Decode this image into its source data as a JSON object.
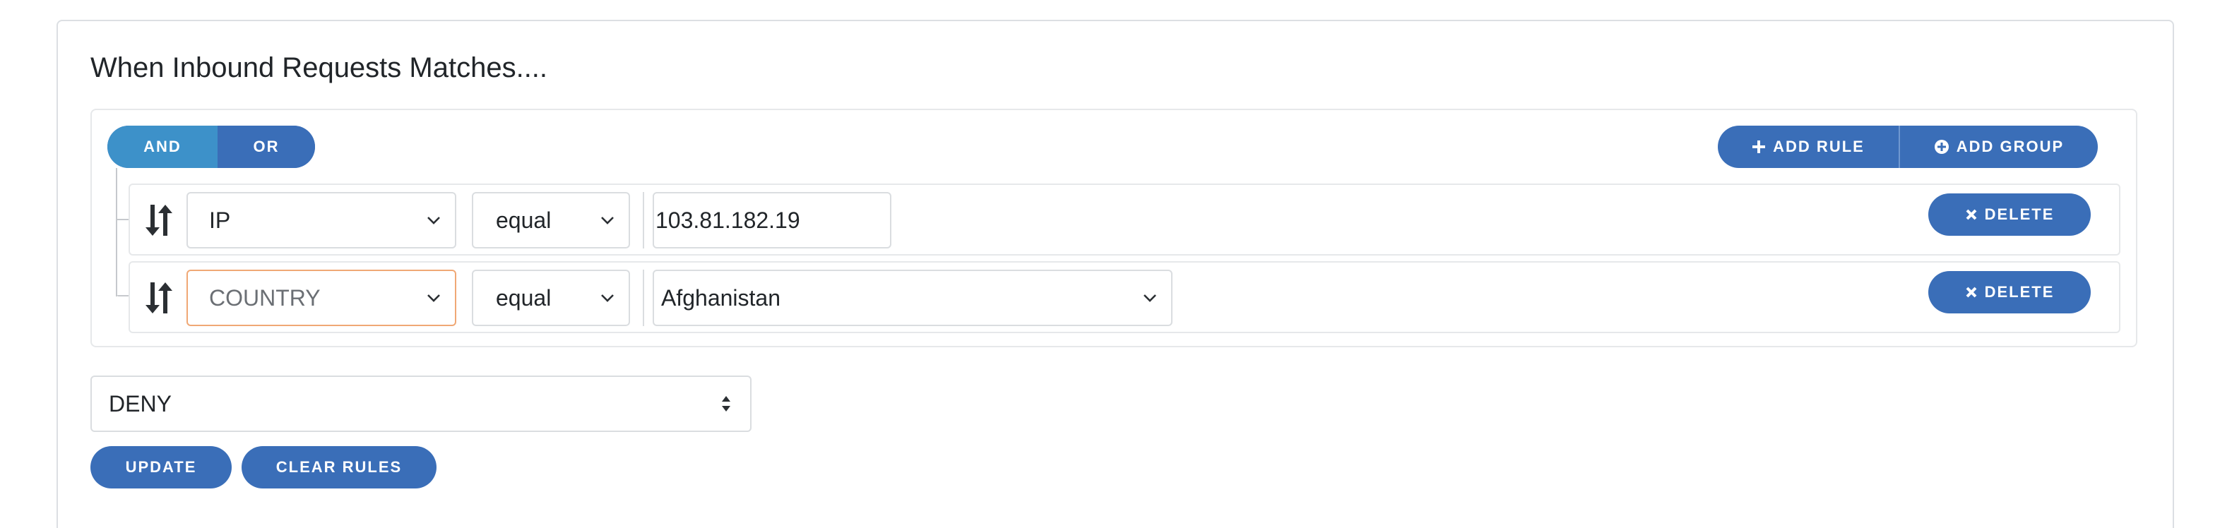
{
  "header": {
    "title": "When Inbound Requests Matches...."
  },
  "combinator": {
    "and_label": "AND",
    "or_label": "OR",
    "selected": "AND"
  },
  "group_actions": {
    "add_rule_label": "ADD RULE",
    "add_group_label": "ADD GROUP"
  },
  "rules": [
    {
      "field": "IP",
      "operator": "equal",
      "value": "103.81.182.19",
      "value_type": "text",
      "delete_label": "DELETE"
    },
    {
      "field": "COUNTRY",
      "operator": "equal",
      "value": "Afghanistan",
      "value_type": "select",
      "delete_label": "DELETE"
    }
  ],
  "action": {
    "selected": "DENY"
  },
  "buttons": {
    "update_label": "UPDATE",
    "clear_label": "CLEAR RULES"
  },
  "colors": {
    "primary": "#3a6eb8",
    "active_segment": "#3d91c9",
    "warning_border": "#f0a875",
    "border": "#dadde0"
  },
  "icons": [
    "plus-icon",
    "plus-circle-icon",
    "sort-icon",
    "chevron-down-icon",
    "close-icon",
    "select-arrows-icon"
  ]
}
